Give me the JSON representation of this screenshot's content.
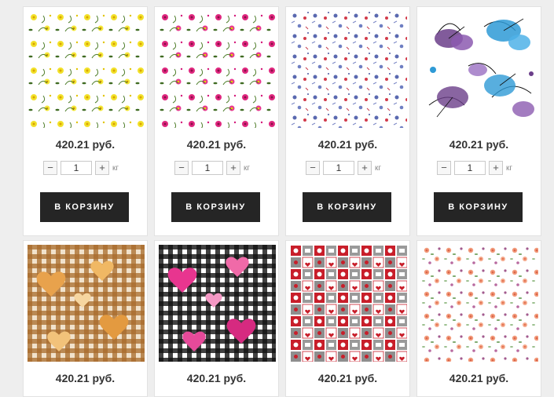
{
  "colors": {
    "page_bg": "#eeeeee",
    "card_bg": "#ffffff",
    "button_bg": "#252525",
    "button_text": "#ffffff"
  },
  "products": [
    {
      "pattern": "yellow-floral-swirls",
      "price": "420.21 руб.",
      "quantity": "1",
      "unit": "кг",
      "minus": "−",
      "plus": "+",
      "cart_label": "В КОРЗИНУ"
    },
    {
      "pattern": "pink-floral-swirls",
      "price": "420.21 руб.",
      "quantity": "1",
      "unit": "кг",
      "minus": "−",
      "plus": "+",
      "cart_label": "В КОРЗИНУ"
    },
    {
      "pattern": "blue-red-small-flowers",
      "price": "420.21 руб.",
      "quantity": "1",
      "unit": "кг",
      "minus": "−",
      "plus": "+",
      "cart_label": "В КОРЗИНУ"
    },
    {
      "pattern": "purple-blue-butterflies",
      "price": "420.21 руб.",
      "quantity": "1",
      "unit": "кг",
      "minus": "−",
      "plus": "+",
      "cart_label": "В КОРЗИНУ"
    },
    {
      "pattern": "brown-gingham-hearts",
      "price": "420.21 руб."
    },
    {
      "pattern": "black-gingham-pink-hearts",
      "price": "420.21 руб."
    },
    {
      "pattern": "red-gray-cafe-tiles",
      "price": "420.21 руб."
    },
    {
      "pattern": "peach-small-roses",
      "price": "420.21 руб."
    }
  ]
}
